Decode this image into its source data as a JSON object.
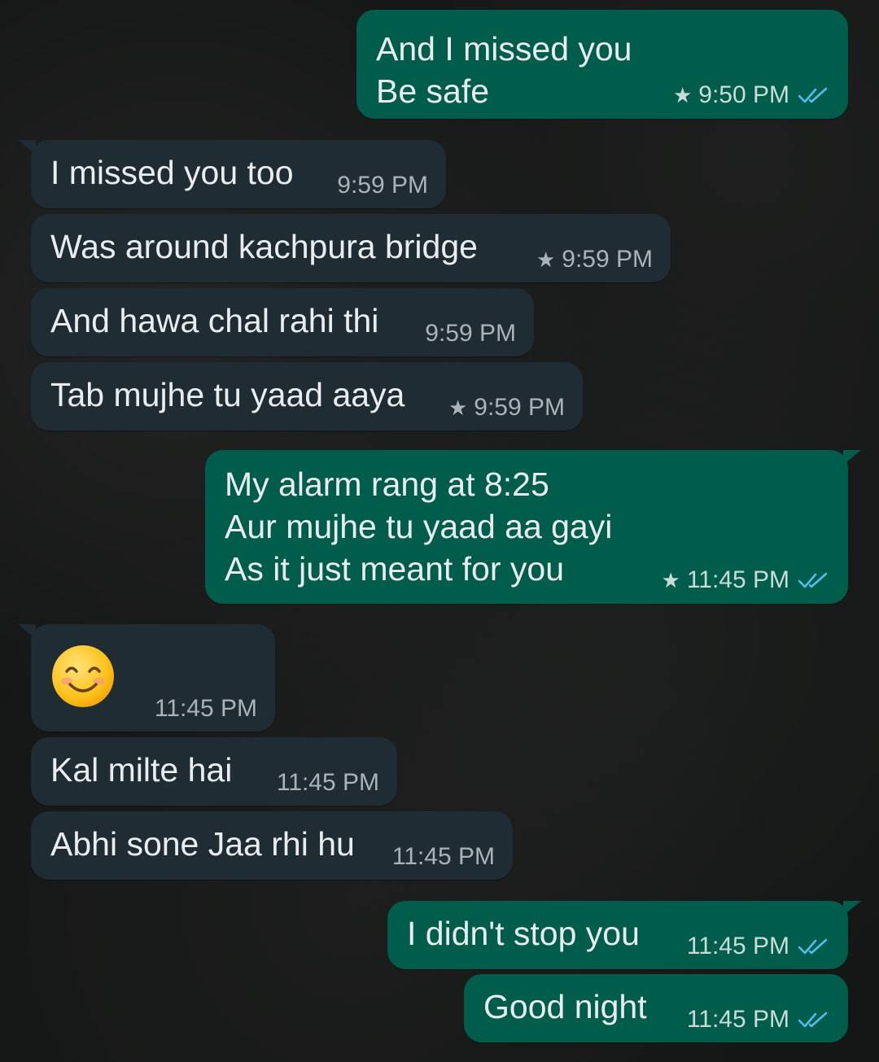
{
  "messages": [
    {
      "direction": "outgoing",
      "text": "And I missed you\nBe safe",
      "time": "9:50 PM",
      "starred": true,
      "read": true
    },
    {
      "direction": "incoming",
      "text": "I missed you too",
      "time": "9:59 PM",
      "starred": false
    },
    {
      "direction": "incoming",
      "text": "Was around kachpura bridge",
      "time": "9:59 PM",
      "starred": true
    },
    {
      "direction": "incoming",
      "text": "And hawa chal rahi thi",
      "time": "9:59 PM",
      "starred": false
    },
    {
      "direction": "incoming",
      "text": "Tab mujhe tu yaad aaya",
      "time": "9:59 PM",
      "starred": true
    },
    {
      "direction": "outgoing",
      "text": "My alarm rang at 8:25\nAur mujhe tu yaad aa gayi\nAs it just meant for you",
      "time": "11:45 PM",
      "starred": true,
      "read": true
    },
    {
      "direction": "incoming",
      "emoji": "smiling-face-with-smiling-eyes",
      "time": "11:45 PM",
      "starred": false
    },
    {
      "direction": "incoming",
      "text": "Kal milte hai",
      "time": "11:45 PM",
      "starred": false
    },
    {
      "direction": "incoming",
      "text": "Abhi sone Jaa rhi hu",
      "time": "11:45 PM",
      "starred": false
    },
    {
      "direction": "outgoing",
      "text": "I didn't stop you",
      "time": "11:45 PM",
      "starred": false,
      "read": true
    },
    {
      "direction": "outgoing",
      "text": "Good night",
      "time": "11:45 PM",
      "starred": false,
      "read": true
    }
  ],
  "colors": {
    "incoming_bubble": "#1f2c34",
    "outgoing_bubble": "#005c4b",
    "message_text": "#e9edef",
    "read_ticks": "#53bdeb",
    "wallpaper": "#151716"
  }
}
